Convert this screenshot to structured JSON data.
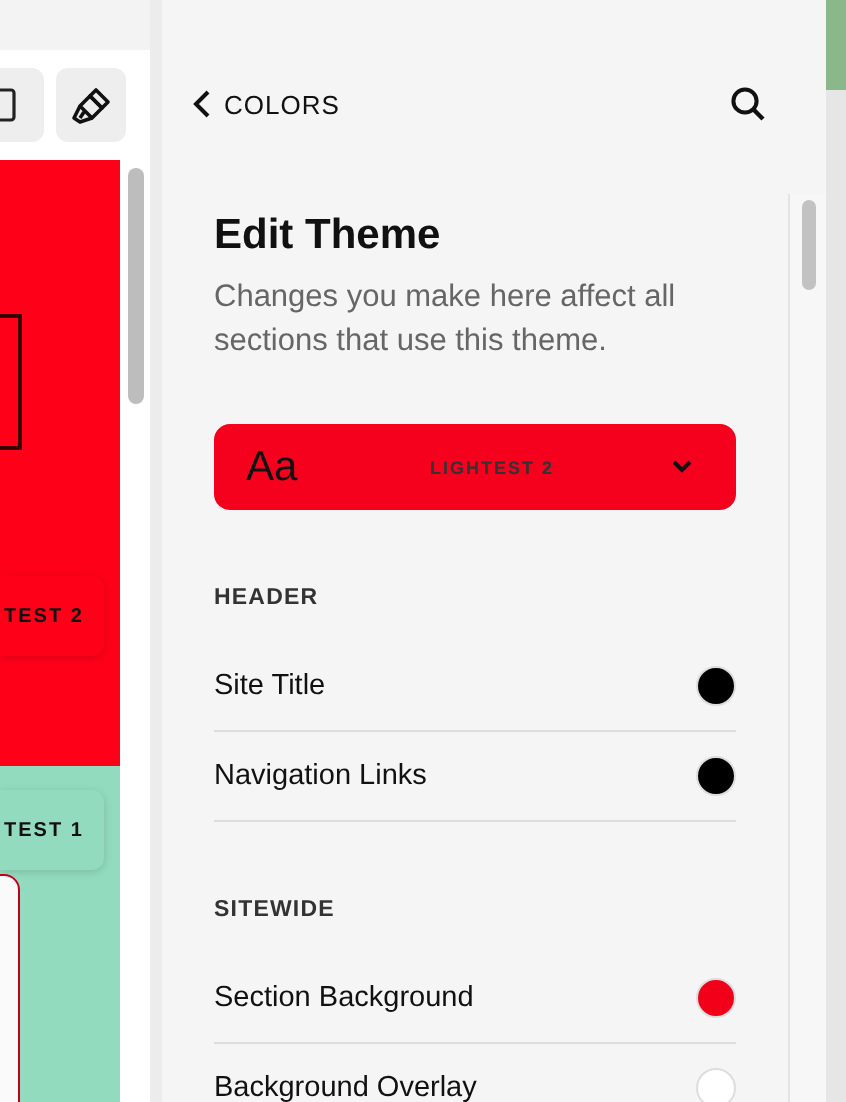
{
  "preview": {
    "sections": [
      {
        "button": "TEST 2",
        "color": "#ff0019"
      },
      {
        "button": "TEST 1",
        "color": "#93dbbf"
      }
    ]
  },
  "panel": {
    "back": "COLORS",
    "title": "Edit Theme",
    "description": "Changes you make here affect all sections that use this theme.",
    "theme_selector": {
      "sample": "Aa",
      "label": "LIGHTEST 2",
      "color": "#f5001d"
    },
    "groups": [
      {
        "heading": "HEADER",
        "items": [
          {
            "label": "Site Title",
            "color": "#000000"
          },
          {
            "label": "Navigation Links",
            "color": "#000000"
          }
        ]
      },
      {
        "heading": "SITEWIDE",
        "items": [
          {
            "label": "Section Background",
            "color": "#f2001a"
          },
          {
            "label": "Background Overlay",
            "color": "#ffffff"
          }
        ]
      }
    ]
  }
}
